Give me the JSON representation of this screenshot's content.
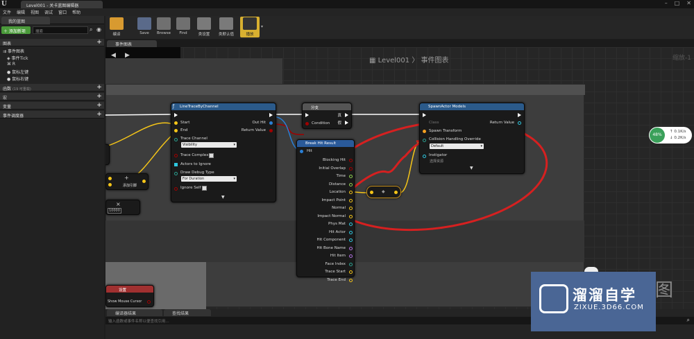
{
  "titlebar": {
    "tab": "Level001 - 关卡蓝图编辑器"
  },
  "menu": [
    "文件",
    "编辑",
    "视图",
    "调试",
    "窗口",
    "帮助"
  ],
  "left_panel": {
    "tab": "我的蓝图",
    "add_new": "添加新项",
    "search_placeholder": "搜索",
    "graphs_section": "图表",
    "event_graph": "事件图表",
    "items": [
      "事件Tick",
      "R",
      "鼠标左键",
      "鼠标右键"
    ],
    "functions_section": "函数",
    "functions_count": "(19 可重载)",
    "macros_section": "宏",
    "variables_section": "变量",
    "dispatchers_section": "事件调度器"
  },
  "toolbar": {
    "buttons": [
      "编译",
      "Save",
      "Browse",
      "Find",
      "类设置",
      "类默认值",
      "播放"
    ]
  },
  "graph": {
    "tab": "事件图表",
    "breadcrumb_root": "Level001",
    "breadcrumb_sep": "〉",
    "breadcrumb_leaf": "事件图表",
    "zoom": "缩放-1"
  },
  "nodes": {
    "trace": {
      "title": "LineTraceByChannel",
      "start": "Start",
      "end": "End",
      "out_hit": "Out Hit",
      "return_value": "Return Value",
      "trace_channel": "Trace Channel",
      "trace_channel_value": "Visibility",
      "trace_complex": "Trace Complex",
      "actors_to_ignore": "Actors to Ignore",
      "draw_debug": "Draw Debug Type",
      "draw_debug_value": "For Duration",
      "ignore_self": "Ignore Self"
    },
    "branch": {
      "title": "分支",
      "true": "真",
      "false": "假",
      "condition": "Condition"
    },
    "break": {
      "title": "Break Hit Result",
      "hit": "Hit",
      "pins": [
        "Blocking Hit",
        "Initial Overlap",
        "Time",
        "Distance",
        "Location",
        "Impact Point",
        "Normal",
        "Impact Normal",
        "Phys Mat",
        "Hit Actor",
        "Hit Component",
        "Hit Bone Name",
        "Hit Item",
        "Face Index",
        "Trace Start",
        "Trace End"
      ]
    },
    "spawn": {
      "title": "SpawnActor Models",
      "return_value": "Return Value",
      "class": "Class",
      "spawn_transform": "Spawn Transform",
      "collision": "Collision Handling Override",
      "collision_value": "Default",
      "instigator": "Instigator",
      "instigator_value": "选择资源"
    },
    "add": {
      "label": "添加引脚"
    },
    "mul": {
      "value": "10000"
    },
    "set": {
      "title": "设置",
      "show_cursor": "Show Mouse Cursor"
    }
  },
  "bottom": {
    "tab1": "编译器结果",
    "tab2": "查找结果",
    "search_placeholder": "输入函数或事件名称以便查找引用..."
  },
  "netmon": {
    "pct": "48%",
    "up": "0.1K/s",
    "down": "0.2K/s"
  },
  "watermark": {
    "cn": "溜溜自学",
    "url": "ZIXUE.3D66.COM",
    "bg_char": "图"
  },
  "colors": {
    "exec": "#ffffff",
    "vector": "#f5c518",
    "bool": "#a00000",
    "struct": "#2a7fd5",
    "object": "#2ec8e0",
    "annotation": "#d62020"
  }
}
